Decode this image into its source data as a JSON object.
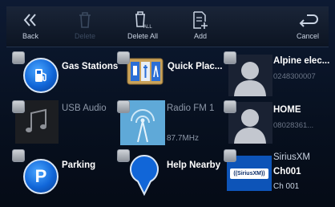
{
  "toolbar": {
    "back_label": "Back",
    "delete_label": "Delete",
    "delete_all_label": "Delete All",
    "add_label": "Add",
    "cancel_label": "Cancel"
  },
  "tiles": [
    {
      "title": "Gas Stations"
    },
    {
      "title": "Quick Plac..."
    },
    {
      "title": "Alpine elec...",
      "sub": "0248300007"
    },
    {
      "title": "USB Audio"
    },
    {
      "title": "Radio FM 1",
      "sub": "87.7MHz"
    },
    {
      "title": "HOME",
      "sub": "08028361..."
    },
    {
      "title": "Parking"
    },
    {
      "title": "Help Nearby"
    },
    {
      "title": "SiriusXM",
      "channel": "Ch001",
      "channel_sub": "Ch 001",
      "logo_text": "((SiriusXM))"
    }
  ],
  "colors": {
    "accent": "#1166d8",
    "background": "#07101f"
  }
}
